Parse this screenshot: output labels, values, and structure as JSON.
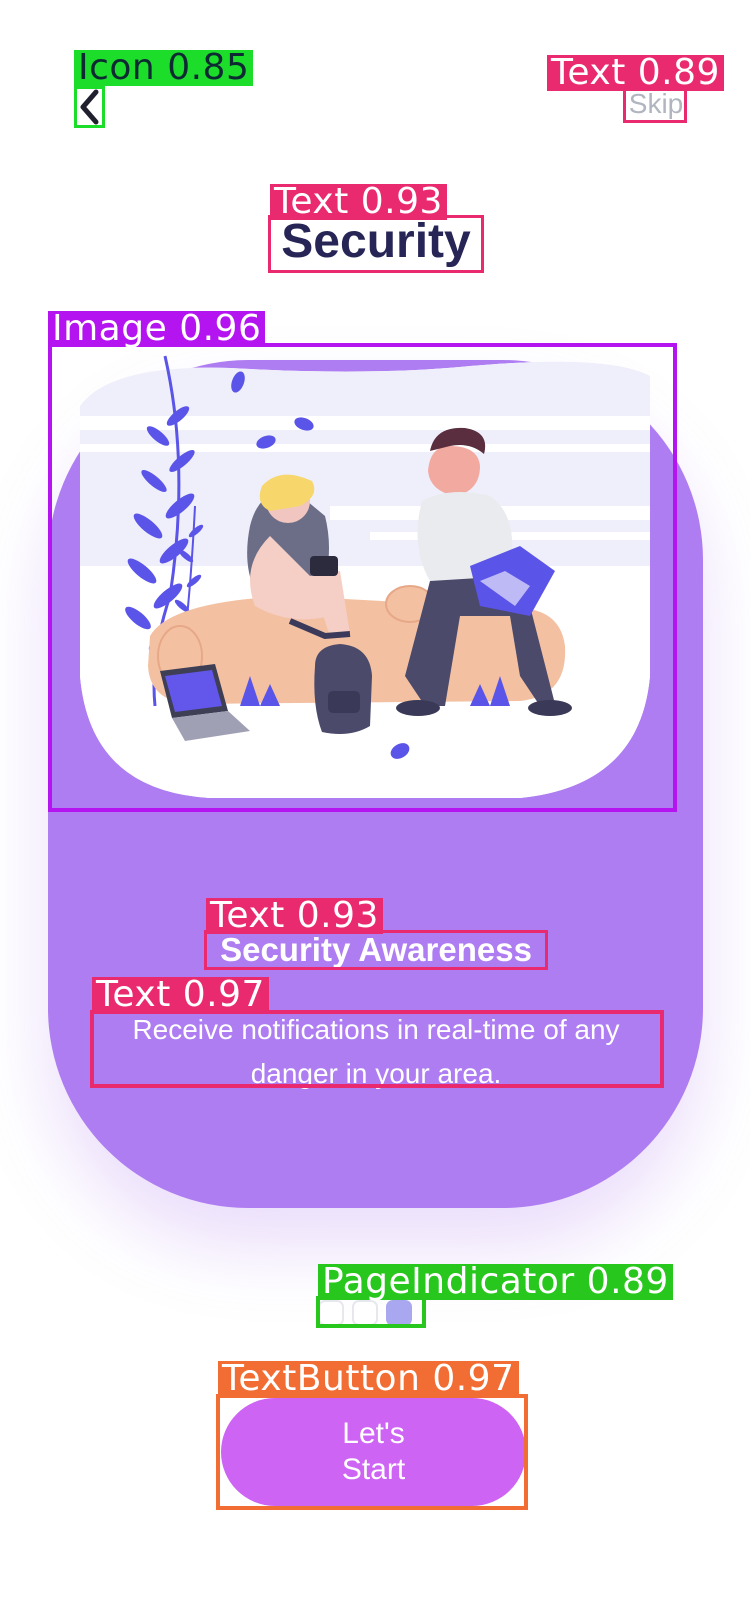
{
  "header": {
    "back_icon": "chevron-left-icon",
    "skip_label": "Skip"
  },
  "title": "Security",
  "card": {
    "heading": "Security Awareness",
    "body": "Receive notifications in real-time of any danger in your area.",
    "color": "#ae7df1"
  },
  "page_indicator": {
    "count": 3,
    "active_index": 2
  },
  "start_button": {
    "label": "Let's Start",
    "color": "#cd64f4"
  },
  "detections": {
    "icon": "Icon 0.85",
    "skip": "Text 0.89",
    "title": "Text 0.93",
    "image": "Image 0.96",
    "heading": "Text 0.93",
    "body": "Text 0.97",
    "indicator": "PageIndicator 0.89",
    "button": "TextButton 0.97"
  },
  "colors": {
    "text_box": "#ea2a6e",
    "icon_box": "#1ddd2b",
    "image_box": "#b414f0",
    "button_box": "#f26d33",
    "indicator_box": "#28c71d"
  }
}
